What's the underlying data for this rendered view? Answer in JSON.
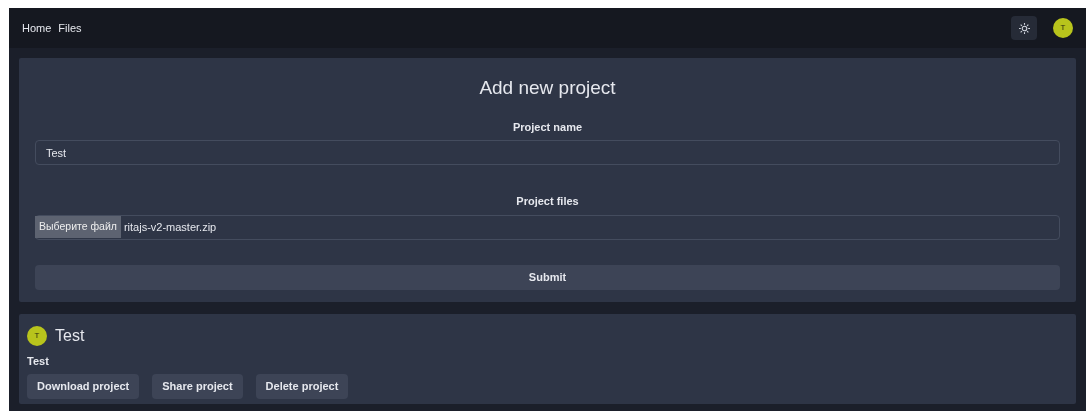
{
  "navbar": {
    "links": [
      {
        "label": "Home"
      },
      {
        "label": "Files"
      }
    ],
    "avatar": "T"
  },
  "form": {
    "title": "Add new project",
    "name_label": "Project name",
    "name_value": "Test",
    "files_label": "Project files",
    "choose_button": "Выберите файл",
    "file_name": "ritajs-v2-master.zip",
    "submit": "Submit"
  },
  "projects": [
    {
      "avatar": "T",
      "title": "Test",
      "description": "Test",
      "buttons": [
        "Download project",
        "Share project",
        "Delete project"
      ]
    }
  ]
}
